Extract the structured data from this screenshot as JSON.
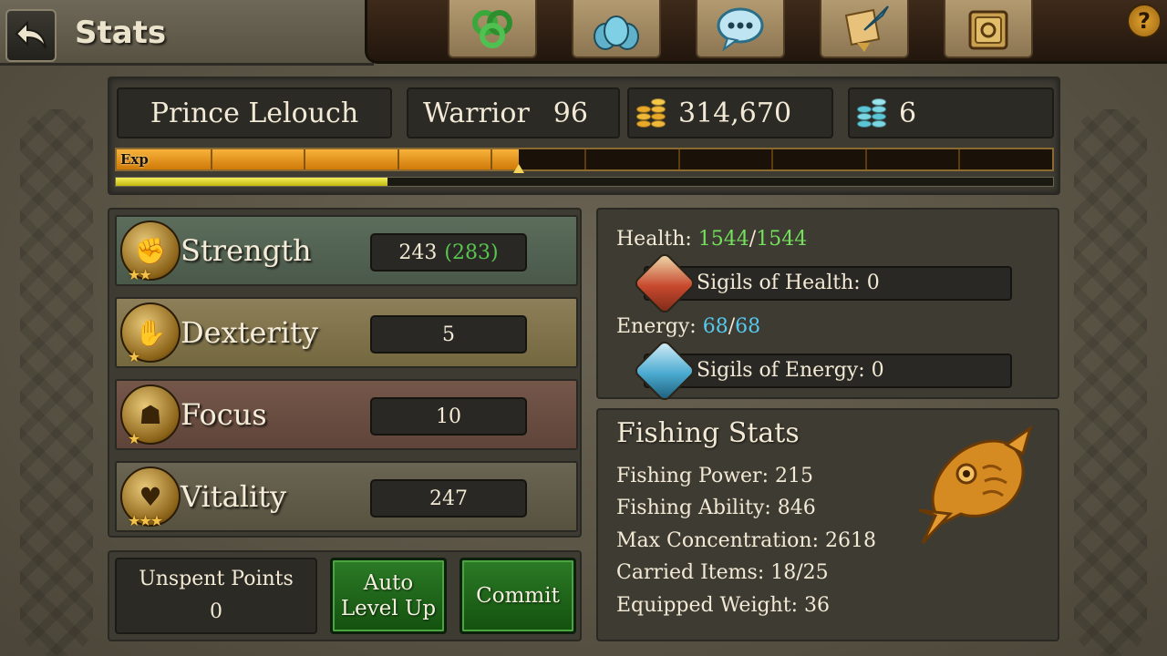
{
  "header": {
    "title": "Stats",
    "nav_icons": [
      "triskelion-icon",
      "guild-icon",
      "chat-icon",
      "quest-scroll-icon",
      "map-icon"
    ],
    "help_label": "?"
  },
  "player": {
    "name": "Prince Lelouch",
    "class": "Warrior",
    "level": "96",
    "gold": "314,670",
    "gems": "6",
    "exp_label": "Exp",
    "exp_progress": 0.43,
    "sub_progress": 0.29
  },
  "stats": [
    {
      "name": "Strength",
      "value": "243",
      "bonus": "(283)",
      "icon": "strength-fist-icon"
    },
    {
      "name": "Dexterity",
      "value": "5",
      "bonus": "",
      "icon": "dexterity-gauntlet-icon"
    },
    {
      "name": "Focus",
      "value": "10",
      "bonus": "",
      "icon": "focus-helm-icon"
    },
    {
      "name": "Vitality",
      "value": "247",
      "bonus": "",
      "icon": "vitality-heart-icon"
    }
  ],
  "unspent": {
    "label": "Unspent Points",
    "value": "0"
  },
  "buttons": {
    "auto_level_line1": "Auto",
    "auto_level_line2": "Level Up",
    "commit": "Commit"
  },
  "vitals": {
    "health_label": "Health:",
    "health_current": "1544",
    "health_max": "1544",
    "sigils_health": "Sigils of Health: 0",
    "energy_label": "Energy:",
    "energy_current": "68",
    "energy_max": "68",
    "sigils_energy": "Sigils of Energy: 0",
    "slash": "/"
  },
  "fishing": {
    "title": "Fishing Stats",
    "lines": [
      "Fishing Power: 215",
      "Fishing Ability: 846",
      "Max Concentration: 2618",
      "Carried Items: 18/25",
      "Equipped Weight: 36"
    ]
  },
  "colors": {
    "health": "#74e05c",
    "energy": "#55c9ee",
    "bonus": "#57c64f",
    "exp_fill": "#f0a020",
    "button_green": "#2b7b26"
  }
}
